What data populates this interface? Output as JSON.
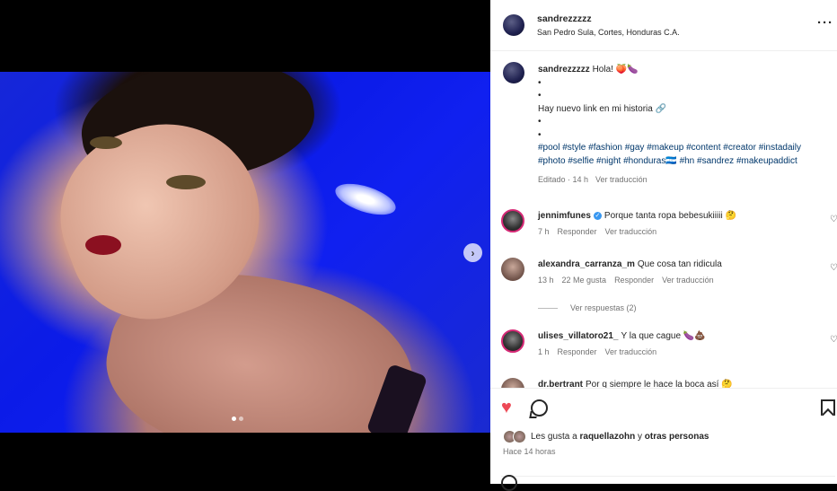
{
  "post": {
    "username": "sandrezzzzz",
    "location": "San Pedro Sula, Cortes, Honduras C.A.",
    "more_icon": "···",
    "carousel": {
      "total_slides": 2,
      "current_slide": 1
    },
    "next_icon": "›"
  },
  "caption": {
    "username": "sandrezzzzz",
    "greeting": "Hola! 🍑🍆",
    "bullet1": "•",
    "bullet2": "•",
    "link_line": "Hay nuevo link en mi historia 🔗",
    "bullet3": "•",
    "bullet4": "•",
    "hashtags": "#pool #style #fashion #gay #makeup #content #creator #instadaily #photo #selfie #night #honduras🇭🇳 #hn #sandrez #makeupaddict",
    "edited": "Editado · 14 h",
    "see_translation": "Ver traducción"
  },
  "comments": [
    {
      "user": "jennimfunes",
      "text": "Porque tanta ropa bebesukiiiii 🤔",
      "time": "7 h",
      "likes": "",
      "reply": "Responder",
      "translate": "Ver traducción",
      "verified": true
    },
    {
      "user": "alexandra_carranza_m",
      "text": "Que cosa tan ridicula",
      "time": "13 h",
      "likes": "22 Me gusta",
      "reply": "Responder",
      "translate": "Ver traducción",
      "verified": false
    },
    {
      "user": "ulises_villatoro21_",
      "text": "Y la que cague 🍆💩",
      "time": "1 h",
      "likes": "",
      "reply": "Responder",
      "translate": "Ver traducción",
      "verified": false
    },
    {
      "user": "dr.bertrant",
      "text": "Por q siempre le hace la boca así 🤔",
      "time": "",
      "likes": "",
      "reply": "",
      "translate": "",
      "verified": false
    }
  ],
  "view_replies": "Ver respuestas (2)",
  "actions": {
    "liked_by_prefix": "Les gusta a",
    "liked_by_user": "raquellazohn",
    "liked_by_suffix": "y",
    "liked_by_others": "otras personas",
    "posted_ago": "Hace 14 horas"
  },
  "colors": {
    "like": "#ed4956",
    "link": "#00376b",
    "secondary": "#737373",
    "story_ring": "#d62976",
    "verified": "#3897f0"
  },
  "icons": [
    "heart-icon",
    "comment-icon",
    "bookmark-icon",
    "more-icon",
    "chevron-right-icon",
    "smiley-icon"
  ]
}
